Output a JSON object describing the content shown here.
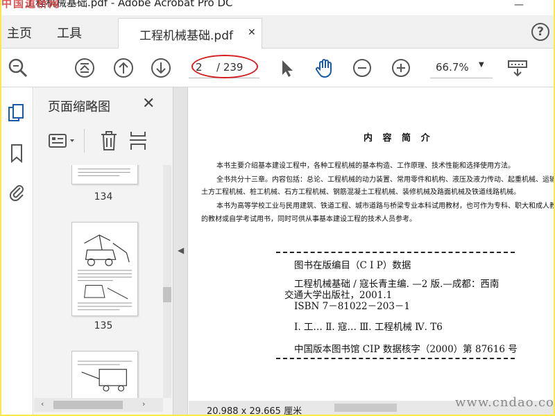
{
  "window": {
    "watermark_left": "中国道桥网",
    "title": "工程机械基础.pdf - Adobe Acrobat Pro DC",
    "minimize_glyph": "—"
  },
  "tabs": {
    "home": "主页",
    "tools": "工具",
    "document": "工程机械基础.pdf",
    "close_glyph": "✕",
    "help_glyph": "?"
  },
  "toolbar": {
    "icons": [
      "zoom-search-icon",
      "first-page-icon",
      "prev-page-icon",
      "next-page-icon",
      "select-cursor-icon",
      "hand-tool-icon",
      "zoom-out-icon",
      "zoom-in-icon",
      "scroll-mode-icon"
    ],
    "page_current": "2",
    "page_total": "/ 239",
    "zoom_value": "66.7%",
    "zoom_caret": "▼"
  },
  "sidebar": {
    "icons": [
      "page-thumbnails-icon",
      "bookmark-icon",
      "attachment-icon"
    ],
    "panel_title": "页面缩略图",
    "panel_close": "✕",
    "tools": [
      "thumbnail-options-icon",
      "delete-page-icon",
      "insert-page-icon"
    ],
    "thumbnails": [
      {
        "label": "134"
      },
      {
        "label": "135"
      },
      {
        "label": ""
      }
    ]
  },
  "document": {
    "heading": "内 容 简 介",
    "paragraphs": [
      "本书主要介绍基本建设工程中，各种工程机械的基本构造、工作原理、技术性能和选择使用方法。",
      "全书共分十三章。内容包括：总论、工程机械的动力装置、常用零件和机构、液压及液力传动、起重机械、运输",
      "土方工程机械、桩工机械、石方工程机械、钢筋混凝土工程机械、装修机械及路面机械及铁道线路机械。",
      "本书为高等学校工业与民用建筑、铁道工程、城市道路与桥梁专业本科试用教材，也可作为专科、职大和成人教",
      "的教材或自学考试用书，同时可供从事基本建设工程的技术人员参考。"
    ],
    "cip": {
      "title": "图书在版编目（C I P）数据",
      "line1": "工程机械基础 / 寇长青主编. —2 版.—成都：西南",
      "line2": "交通大学出版社，2001.1",
      "line3": "ISBN 7－81022－203－1",
      "line4": "Ⅰ. 工…   Ⅱ. 寇…   Ⅲ. 工程机械   Ⅳ. T6",
      "line5": "中国版本图书馆 CIP 数据核字（2000）第 87616 号"
    }
  },
  "status": {
    "page_size": "20.988 x 29.665 厘米",
    "watermark_right": "www.cndao.com"
  },
  "colors": {
    "frame_border": "#fde84a",
    "annotation_ring": "#d42020",
    "acrobat_blue": "#1b5aa7"
  }
}
